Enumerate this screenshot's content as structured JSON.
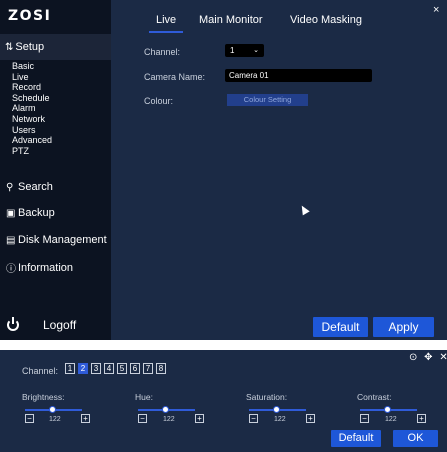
{
  "brand": {
    "logo": "ZOSI"
  },
  "sidebar": {
    "setup_label": "Setup",
    "setup_items": [
      "Basic",
      "Live",
      "Record",
      "Schedule",
      "Alarm",
      "Network",
      "Users",
      "Advanced",
      "PTZ"
    ],
    "search_label": "Search",
    "backup_label": "Backup",
    "disk_label": "Disk Management",
    "info_label": "Information",
    "logoff_label": "Logoff"
  },
  "tabs": [
    {
      "label": "Live",
      "active": true
    },
    {
      "label": "Main Monitor",
      "active": false
    },
    {
      "label": "Video Masking",
      "active": false
    }
  ],
  "form": {
    "channel_label": "Channel:",
    "channel_value": "1",
    "camera_name_label": "Camera Name:",
    "camera_name_value": "Camera 01",
    "colour_label": "Colour:",
    "colour_button": "Colour Setting"
  },
  "actions": {
    "default_label": "Default",
    "apply_label": "Apply",
    "close_glyph": "×"
  },
  "panel": {
    "channel_label": "Channel:",
    "channels": [
      "1",
      "2",
      "3",
      "4",
      "5",
      "6",
      "7",
      "8"
    ],
    "selected_channel": "2",
    "icons": "⊙ ✥ ✕",
    "adjustments": [
      {
        "label": "Brightness:",
        "value": "122",
        "level": 0.48
      },
      {
        "label": "Hue:",
        "value": "122",
        "level": 0.48
      },
      {
        "label": "Saturation:",
        "value": "122",
        "level": 0.48
      },
      {
        "label": "Contrast:",
        "value": "122",
        "level": 0.48
      }
    ],
    "minus": "−",
    "plus": "+",
    "default_label": "Default",
    "ok_label": "OK"
  },
  "colors": {
    "accent": "#1e57d8",
    "window_bg": "#1b2a45",
    "sidebar_bg": "#0c1321"
  }
}
